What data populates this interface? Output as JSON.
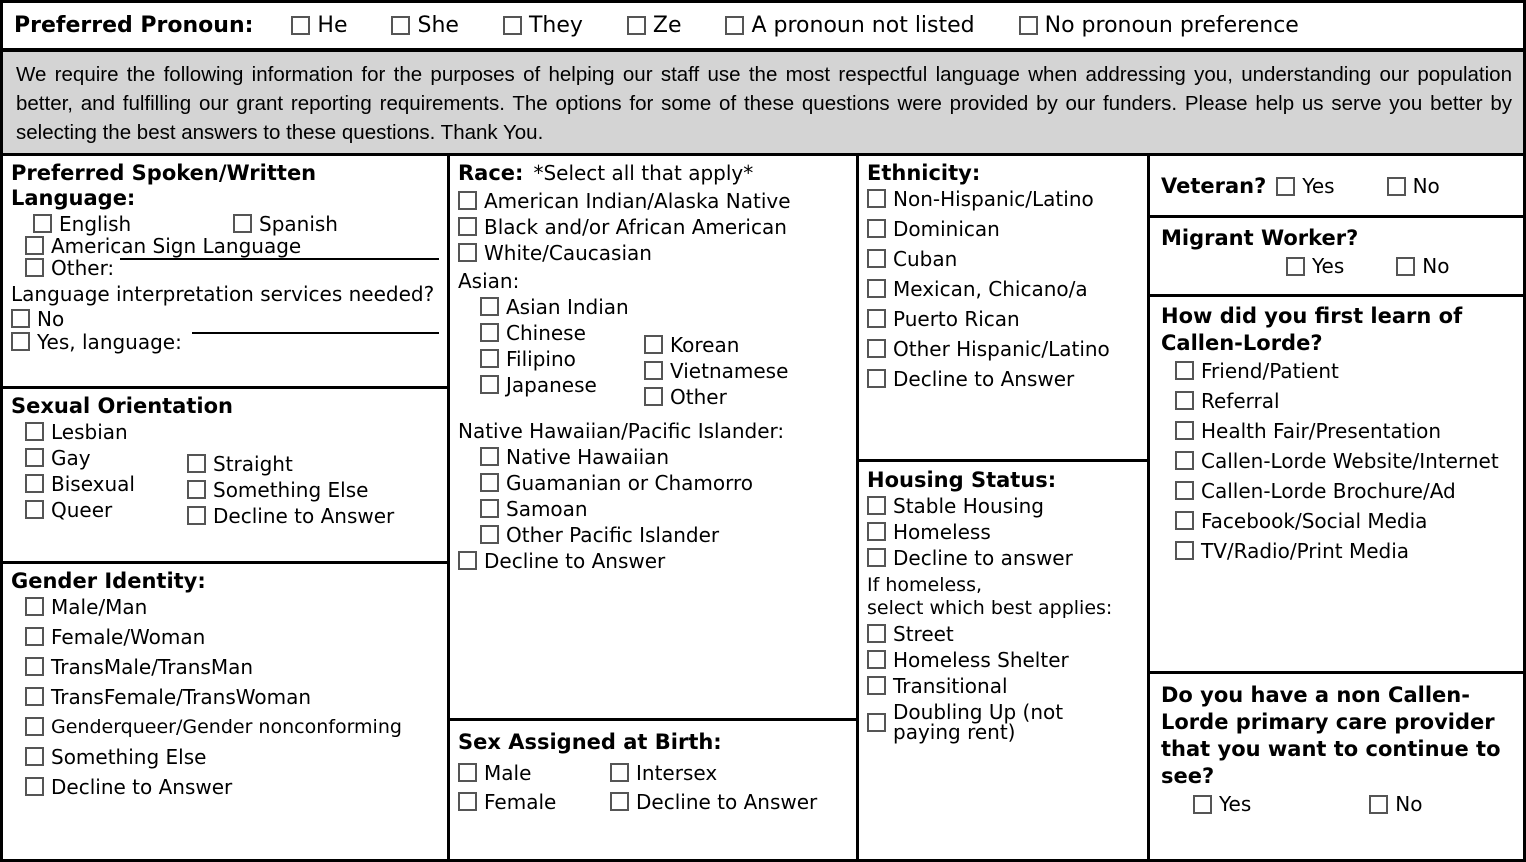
{
  "pronoun": {
    "title": "Preferred Pronoun:",
    "options": [
      "He",
      "She",
      "They",
      "Ze",
      "A pronoun not listed",
      "No pronoun preference"
    ]
  },
  "notice": {
    "text": "We require the following information for the purposes of helping our staff use the most respectful language when addressing you, understanding our population better, and fulfilling our grant reporting requirements. The options for some of these questions were provided by our funders. Please help us serve you better by selecting the best answers to these questions. Thank You."
  },
  "language": {
    "title": "Preferred Spoken/Written Language:",
    "english": "English",
    "spanish": "Spanish",
    "asl": "American Sign Language",
    "other": "Other:",
    "interp_question": "Language interpretation services needed?",
    "interp_no": "No",
    "interp_yes": "Yes, language:"
  },
  "orientation": {
    "title": "Sexual Orientation",
    "left": [
      "Lesbian",
      "Gay",
      "Bisexual",
      "Queer"
    ],
    "right": [
      "Straight",
      "Something Else",
      "Decline to Answer"
    ]
  },
  "gender": {
    "title": "Gender Identity:",
    "options": [
      "Male/Man",
      "Female/Woman",
      "TransMale/TransMan",
      "TransFemale/TransWoman",
      "Genderqueer/Gender nonconforming",
      "Something Else",
      "Decline to Answer"
    ]
  },
  "race": {
    "title": "Race:",
    "subtitle": "*Select all that apply*",
    "top": [
      "American Indian/Alaska Native",
      "Black and/or African American",
      "White/Caucasian"
    ],
    "asian_label": "Asian:",
    "asian_left": [
      "Asian Indian",
      "Chinese",
      "Filipino",
      "Japanese"
    ],
    "asian_right": [
      "Korean",
      "Vietnamese",
      "Other"
    ],
    "nhpi_label": "Native Hawaiian/Pacific Islander:",
    "nhpi": [
      "Native Hawaiian",
      "Guamanian or Chamorro",
      "Samoan",
      "Other Pacific Islander"
    ],
    "decline": "Decline to Answer"
  },
  "sex_at_birth": {
    "title": "Sex Assigned at Birth:",
    "left": [
      "Male",
      "Female"
    ],
    "right": [
      "Intersex",
      "Decline to Answer"
    ]
  },
  "ethnicity": {
    "title": "Ethnicity:",
    "options": [
      "Non-Hispanic/Latino",
      "Dominican",
      "Cuban",
      "Mexican, Chicano/a",
      "Puerto Rican",
      "Other Hispanic/Latino",
      "Decline to Answer"
    ]
  },
  "housing": {
    "title": "Housing Status:",
    "options": [
      "Stable Housing",
      "Homeless",
      "Decline to answer"
    ],
    "note_line1": "If homeless,",
    "note_line2": "select which best applies:",
    "sub_options": [
      "Street",
      "Homeless Shelter",
      "Transitional"
    ],
    "doubling_line1": "Doubling Up (not",
    "doubling_line2": "paying rent)"
  },
  "veteran": {
    "title": "Veteran?",
    "yes": "Yes",
    "no": "No"
  },
  "migrant": {
    "title": "Migrant Worker?",
    "yes": "Yes",
    "no": "No"
  },
  "learn": {
    "title_line1": "How did you first learn of",
    "title_line2": "Callen-Lorde?",
    "options": [
      "Friend/Patient",
      "Referral",
      "Health Fair/Presentation",
      "Callen-Lorde Website/Internet",
      "Callen-Lorde Brochure/Ad",
      "Facebook/Social Media",
      "TV/Radio/Print Media"
    ]
  },
  "pcp": {
    "title_line1": "Do you have a non Callen-",
    "title_line2": "Lorde primary care provider",
    "title_line3": "that you want to continue to",
    "title_line4": "see?",
    "yes": "Yes",
    "no": "No"
  }
}
